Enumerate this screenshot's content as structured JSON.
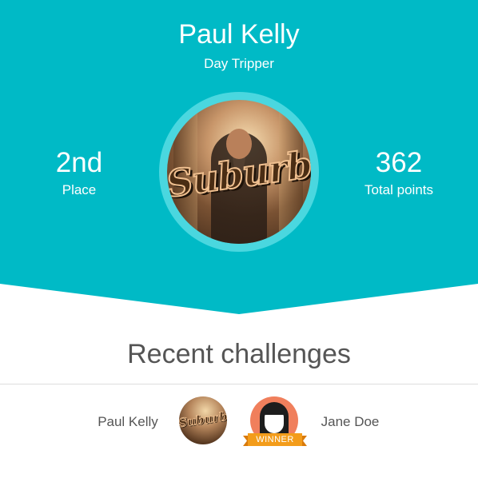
{
  "profile": {
    "name": "Paul Kelly",
    "title": "Day Tripper",
    "photo_badge": "Suburb"
  },
  "stats": {
    "place_value": "2nd",
    "place_label": "Place",
    "points_value": "362",
    "points_label": "Total points"
  },
  "recent": {
    "heading": "Recent challenges",
    "challenge": {
      "player_left": "Paul Kelly",
      "player_left_badge": "Suburb",
      "player_right": "Jane Doe",
      "winner_label": "WINNER"
    }
  },
  "colors": {
    "header_bg": "#00bac6",
    "ring": "#4ad7df",
    "winner": "#f39c1a",
    "jane_avatar_bg": "#f07f5c"
  }
}
